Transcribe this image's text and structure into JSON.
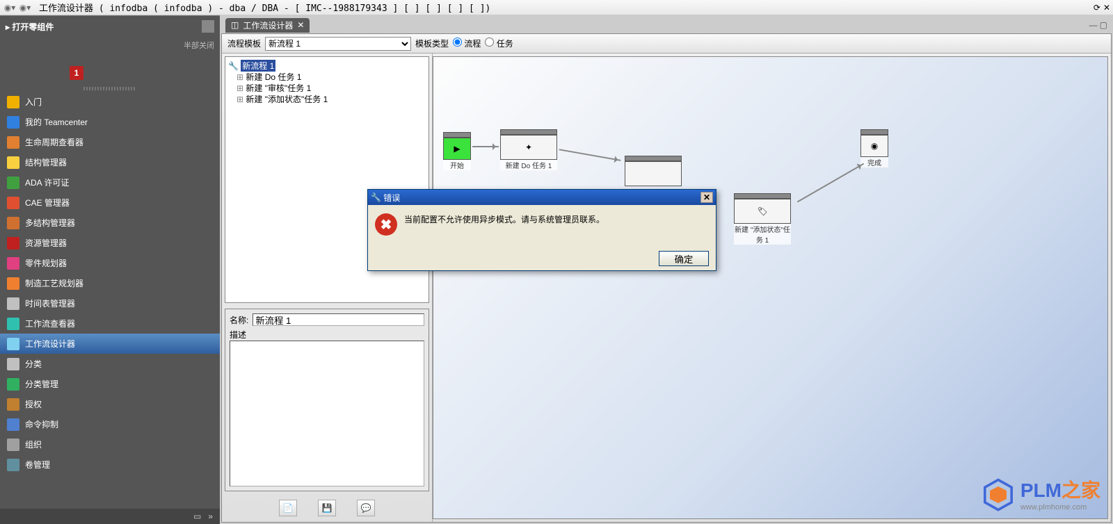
{
  "app_title": "工作流设计器  ( infodba ( infodba ) - dba / DBA - [ IMC--1988179343 ] [  ] [ ] [  ]  [  ])",
  "sidebar": {
    "open_components": "打开零组件",
    "close_all": "半部关闭",
    "badge": "1",
    "items": [
      {
        "label": "入门",
        "iconColor": "#f0b000"
      },
      {
        "label": "我的 Teamcenter",
        "iconColor": "#3080e0"
      },
      {
        "label": "生命周期查看器",
        "iconColor": "#e08030"
      },
      {
        "label": "结构管理器",
        "iconColor": "#f7d040"
      },
      {
        "label": "ADA 许可证",
        "iconColor": "#40a040"
      },
      {
        "label": "CAE 管理器",
        "iconColor": "#e05030"
      },
      {
        "label": "多结构管理器",
        "iconColor": "#d07030"
      },
      {
        "label": "资源管理器",
        "iconColor": "#c02020"
      },
      {
        "label": "零件规划器",
        "iconColor": "#e04080"
      },
      {
        "label": "制造工艺规划器",
        "iconColor": "#f08030"
      },
      {
        "label": "时间表管理器",
        "iconColor": "#c0c0c0"
      },
      {
        "label": "工作流查看器",
        "iconColor": "#30c0b0"
      },
      {
        "label": "工作流设计器",
        "iconColor": "#80d0f0",
        "selected": true
      },
      {
        "label": "分类",
        "iconColor": "#c0c0c0"
      },
      {
        "label": "分类管理",
        "iconColor": "#30b060"
      },
      {
        "label": "授权",
        "iconColor": "#c08030"
      },
      {
        "label": "命令抑制",
        "iconColor": "#5080d0"
      },
      {
        "label": "组织",
        "iconColor": "#a0a0a0"
      },
      {
        "label": "卷管理",
        "iconColor": "#6090a0"
      }
    ]
  },
  "tab": {
    "label": "工作流设计器"
  },
  "toolbar": {
    "template_label": "流程模板",
    "template_value": "新流程 1",
    "type_label": "模板类型",
    "radio_process": "流程",
    "radio_task": "任务"
  },
  "tree": {
    "root": "新流程 1",
    "nodes": [
      "新建 Do 任务 1",
      "新建 \"审核\"任务 1",
      "新建 \"添加状态\"任务 1"
    ]
  },
  "props": {
    "name_label": "名称:",
    "name_value": "新流程 1",
    "desc_label": "描述"
  },
  "nodes": {
    "start": "开始",
    "do": "新建 Do 任务 1",
    "add": "新建 \"添加状态\"任务 1",
    "end": "完成"
  },
  "dialog": {
    "title": "错误",
    "message": "当前配置不允许使用异步模式。请与系统管理员联系。",
    "ok": "确定"
  },
  "watermark": {
    "brand": "PLM",
    "suffix": "之家",
    "url": "www.plmhome.com"
  }
}
